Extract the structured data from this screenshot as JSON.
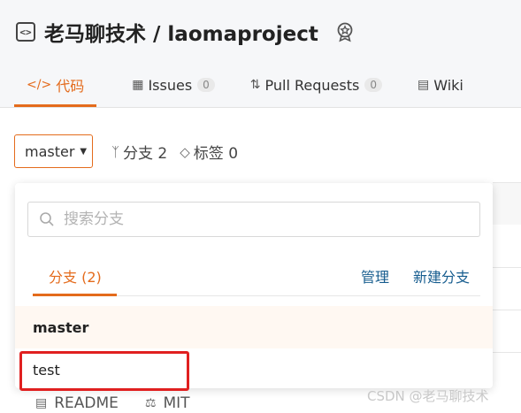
{
  "repo": {
    "title": "老马聊技术 / laomaproject",
    "icon": "code-icon",
    "badge_icon": "award-icon"
  },
  "tabs": [
    {
      "label": "代码",
      "icon": "code-icon",
      "active": true
    },
    {
      "label": "Issues",
      "icon": "issues-icon",
      "count": "0"
    },
    {
      "label": "Pull Requests",
      "icon": "pull-request-icon",
      "count": "0"
    },
    {
      "label": "Wiki",
      "icon": "wiki-icon"
    }
  ],
  "branch_bar": {
    "current_branch": "master",
    "branches_label": "分支 2",
    "tags_label": "标签 0"
  },
  "dropdown": {
    "search_placeholder": "搜索分支",
    "tab_branches": "分支 (2)",
    "manage_link": "管理",
    "new_branch_link": "新建分支",
    "branches": [
      "master",
      "test"
    ]
  },
  "files_footer": {
    "readme": "README",
    "license": "MIT"
  },
  "watermark": "CSDN @老马聊技术",
  "colors": {
    "accent": "#e46b1c",
    "link": "#175d8f",
    "highlight": "#e02020"
  }
}
